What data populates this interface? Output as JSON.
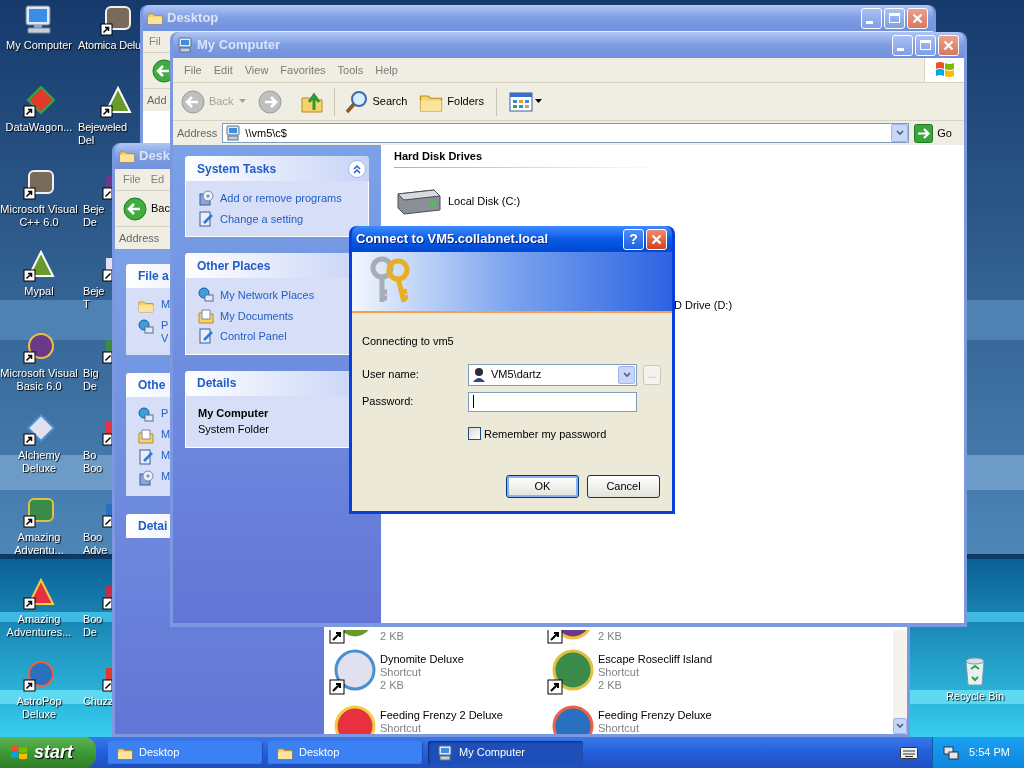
{
  "desktop_icons": [
    {
      "lines": [
        "My Computer"
      ],
      "kind": "computer"
    },
    {
      "lines": [
        "DataWagon..."
      ],
      "kind": "shortcut"
    },
    {
      "lines": [
        "Microsoft Visual",
        "C++ 6.0"
      ],
      "kind": "shortcut"
    },
    {
      "lines": [
        "Mypal"
      ],
      "kind": "shortcut"
    },
    {
      "lines": [
        "Microsoft Visual",
        "Basic 6.0"
      ],
      "kind": "shortcut"
    },
    {
      "lines": [
        "Alchemy",
        "Deluxe"
      ],
      "kind": "shortcut"
    },
    {
      "lines": [
        "Amazing",
        "Adventu..."
      ],
      "kind": "shortcut"
    },
    {
      "lines": [
        "Amazing",
        "Adventures..."
      ],
      "kind": "shortcut"
    },
    {
      "lines": [
        "AstroPop",
        "Deluxe"
      ],
      "kind": "shortcut"
    }
  ],
  "desktop_icons_column_2": [
    {
      "lines": [
        "Atomica Delu"
      ]
    },
    {
      "lines": [
        "Bejeweled",
        "Del"
      ]
    },
    {
      "lines": [
        "Beje",
        "De"
      ]
    },
    {
      "lines": [
        "Beje",
        "T"
      ]
    },
    {
      "lines": [
        "Big",
        "De"
      ]
    },
    {
      "lines": [
        "Bo",
        "Boo"
      ]
    },
    {
      "lines": [
        "Boo",
        "Adve"
      ]
    },
    {
      "lines": [
        "Boo",
        "De"
      ]
    },
    {
      "lines": [
        "Chuzz"
      ]
    }
  ],
  "recycle_bin": {
    "label": "Recycle Bin"
  },
  "back_window": {
    "title": "Desktop",
    "menu": [
      "Fil"
    ],
    "address_label": "Add"
  },
  "middle_window": {
    "title": "Desk",
    "menu": [
      "File",
      "Ed"
    ],
    "back_label": "Bac",
    "address_label": "Address",
    "task_groups": [
      {
        "title": "File a",
        "items": [
          {
            "lines": [
              "M"
            ]
          },
          {
            "lines": [
              "P",
              "V"
            ]
          }
        ]
      },
      {
        "title": "Othe",
        "items": [
          {
            "lines": [
              "P"
            ]
          },
          {
            "lines": [
              "M"
            ]
          },
          {
            "lines": [
              "M"
            ]
          },
          {
            "lines": [
              "M"
            ]
          }
        ]
      },
      {
        "title": "Detai"
      }
    ],
    "files": [
      {
        "details": [
          "2 KB"
        ]
      },
      {
        "details": [
          "2 KB"
        ]
      },
      {
        "name": "Dynomite Deluxe",
        "details": [
          "Shortcut",
          "2 KB"
        ]
      },
      {
        "name": "Escape Rosecliff Island",
        "details": [
          "Shortcut",
          "2 KB"
        ]
      },
      {
        "name": "Feeding Frenzy 2 Deluxe",
        "details": [
          "Shortcut"
        ]
      },
      {
        "name": "Feeding Frenzy Deluxe",
        "details": [
          "Shortcut"
        ]
      }
    ]
  },
  "my_computer_window": {
    "title": "My Computer",
    "menu": [
      "File",
      "Edit",
      "View",
      "Favorites",
      "Tools",
      "Help"
    ],
    "toolbar": {
      "back": "Back",
      "back_disabled": true,
      "search": "Search",
      "folders": "Folders"
    },
    "address_label": "Address",
    "address": "\\\\vm5\\c$",
    "go": "Go",
    "task_groups": [
      {
        "kind": "links",
        "title": "System Tasks",
        "collapsible": true,
        "items": [
          "Add or remove programs",
          "Change a setting"
        ]
      },
      {
        "kind": "links",
        "title": "Other Places",
        "collapsible": false,
        "items": [
          "My Network Places",
          "My Documents",
          "Control Panel"
        ]
      },
      {
        "kind": "details",
        "title": "Details",
        "collapsible": false,
        "name": "My Computer",
        "text": "System Folder"
      }
    ],
    "section_header": "Hard Disk Drives",
    "drive": "Local Disk (C:)",
    "partial_drive": "D Drive (D:)"
  },
  "dialog": {
    "title": "Connect to VM5.collabnet.local",
    "help_button": "?",
    "message": "Connecting to vm5",
    "user_label": "User name:",
    "user_value": "VM5\\dartz",
    "browse_button": "...",
    "browse_disabled": true,
    "password_label": "Password:",
    "password_focused": true,
    "remember": {
      "label": "Remember my password",
      "checked": false
    },
    "buttons": [
      {
        "label": "OK",
        "default": true
      },
      {
        "label": "Cancel",
        "default": false
      }
    ]
  },
  "taskbar": {
    "start": "start",
    "tasks": [
      {
        "label": "Desktop",
        "kind": "folder",
        "selected": false
      },
      {
        "label": "Desktop",
        "kind": "folder",
        "selected": false
      },
      {
        "label": "My Computer",
        "kind": "computer",
        "selected": true
      }
    ],
    "clock": "5:54 PM"
  }
}
